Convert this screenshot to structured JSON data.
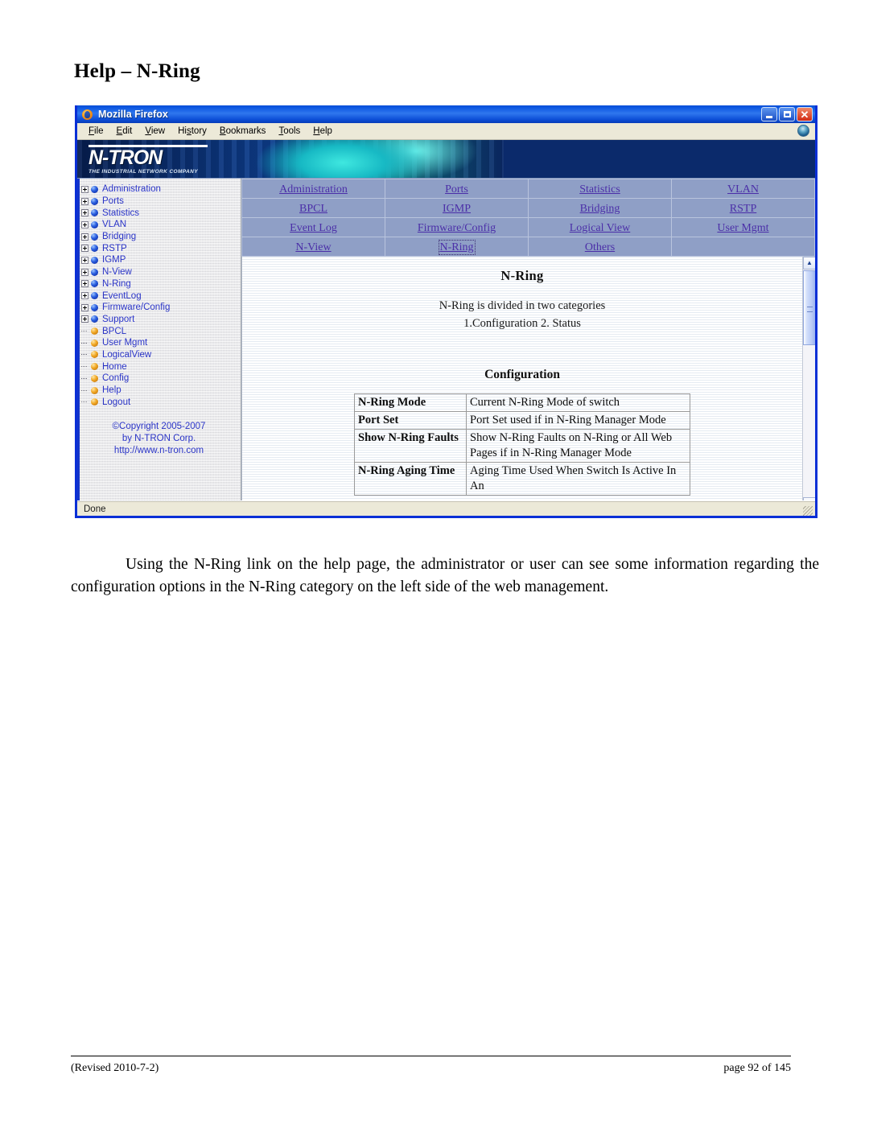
{
  "document": {
    "heading": "Help – N-Ring",
    "paragraph": "Using the N-Ring link on the help page, the administrator or user can see some information regarding the configuration options in the N-Ring category on the left side of the web management.",
    "footer_left": "(Revised 2010-7-2)",
    "footer_right": "page 92 of 145"
  },
  "browser": {
    "title": "Mozilla Firefox",
    "icon": "firefox-icon",
    "window_controls": {
      "minimize": "_",
      "maximize": "□",
      "close": "✕"
    },
    "menu": [
      {
        "label": "File",
        "accesskey": "F"
      },
      {
        "label": "Edit",
        "accesskey": "E"
      },
      {
        "label": "View",
        "accesskey": "V"
      },
      {
        "label": "History",
        "accesskey": "s"
      },
      {
        "label": "Bookmarks",
        "accesskey": "B"
      },
      {
        "label": "Tools",
        "accesskey": "T"
      },
      {
        "label": "Help",
        "accesskey": "H"
      }
    ],
    "status": "Done"
  },
  "banner": {
    "brand": "N-TRON",
    "tagline": "THE INDUSTRIAL NETWORK COMPANY",
    "color_dark": "#0b2a6b",
    "color_accent": "#17b9c4"
  },
  "sidebar": {
    "tree": [
      {
        "label": "Administration",
        "type": "branch",
        "bullet": "blue"
      },
      {
        "label": "Ports",
        "type": "branch",
        "bullet": "blue"
      },
      {
        "label": "Statistics",
        "type": "branch",
        "bullet": "blue"
      },
      {
        "label": "VLAN",
        "type": "branch",
        "bullet": "blue"
      },
      {
        "label": "Bridging",
        "type": "branch",
        "bullet": "blue"
      },
      {
        "label": "RSTP",
        "type": "branch",
        "bullet": "blue"
      },
      {
        "label": "IGMP",
        "type": "branch",
        "bullet": "blue"
      },
      {
        "label": "N-View",
        "type": "branch",
        "bullet": "blue"
      },
      {
        "label": "N-Ring",
        "type": "branch",
        "bullet": "blue"
      },
      {
        "label": "EventLog",
        "type": "branch",
        "bullet": "blue"
      },
      {
        "label": "Firmware/Config",
        "type": "branch",
        "bullet": "blue"
      },
      {
        "label": "Support",
        "type": "branch",
        "bullet": "blue"
      },
      {
        "label": "BPCL",
        "type": "leaf",
        "bullet": "gold"
      },
      {
        "label": "User Mgmt",
        "type": "leaf",
        "bullet": "gold"
      },
      {
        "label": "LogicalView",
        "type": "leaf",
        "bullet": "gold"
      },
      {
        "label": "Home",
        "type": "leaf",
        "bullet": "gold"
      },
      {
        "label": "Config",
        "type": "leaf",
        "bullet": "gold"
      },
      {
        "label": "Help",
        "type": "leaf",
        "bullet": "gold"
      },
      {
        "label": "Logout",
        "type": "leaf",
        "bullet": "gold"
      }
    ],
    "copyright": [
      "©Copyright 2005-2007",
      "by N-TRON Corp.",
      "http://www.n-tron.com"
    ],
    "link_color": "#2b35c8"
  },
  "nav_table": {
    "rows": [
      [
        {
          "label": "Administration",
          "focused": false
        },
        {
          "label": "Ports",
          "focused": false
        },
        {
          "label": "Statistics",
          "focused": false
        },
        {
          "label": "VLAN",
          "focused": false
        }
      ],
      [
        {
          "label": "BPCL",
          "focused": false
        },
        {
          "label": "IGMP",
          "focused": false
        },
        {
          "label": "Bridging",
          "focused": false
        },
        {
          "label": "RSTP",
          "focused": false
        }
      ],
      [
        {
          "label": "Event Log",
          "focused": false
        },
        {
          "label": "Firmware/Config",
          "focused": false
        },
        {
          "label": "Logical View",
          "focused": false
        },
        {
          "label": "User Mgmt",
          "focused": false
        }
      ],
      [
        {
          "label": "N-View",
          "focused": false
        },
        {
          "label": "N-Ring",
          "focused": true
        },
        {
          "label": "Others",
          "focused": false
        },
        {
          "label": "",
          "focused": false
        }
      ]
    ],
    "cell_bg": "#8f9fc6",
    "link_color": "#4b2fa8"
  },
  "content": {
    "heading": "N-Ring",
    "intro_line1": "N-Ring is divided in two categories",
    "intro_line2": "1.Configuration   2. Status",
    "section_heading": "Configuration",
    "config_rows": [
      {
        "key": "N-Ring Mode",
        "value": "Current N-Ring Mode of switch"
      },
      {
        "key": "Port Set",
        "value": "Port Set used if in N-Ring Manager Mode"
      },
      {
        "key": "Show N-Ring Faults",
        "value": "Show N-Ring Faults on N-Ring or All Web Pages if in N-Ring Manager Mode"
      },
      {
        "key": "N-Ring Aging Time",
        "value": "Aging Time Used When Switch Is Active In An"
      }
    ]
  },
  "scrollbar": {
    "up_arrow": "▲",
    "down_arrow": "▼"
  }
}
